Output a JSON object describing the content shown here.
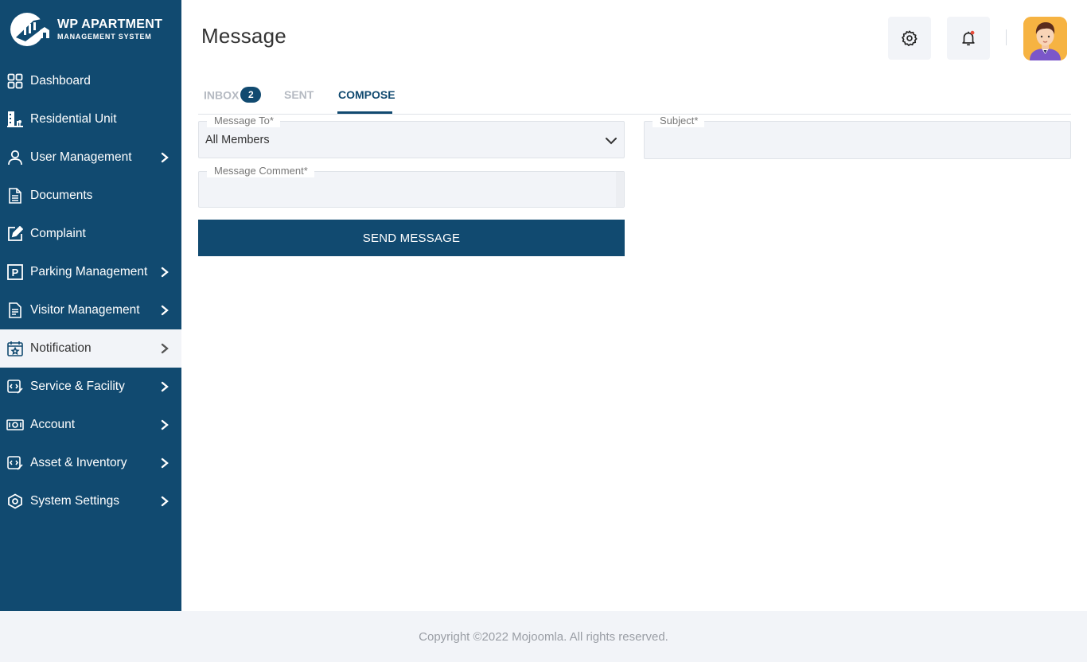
{
  "app": {
    "logo_title": "WP APARTMENT",
    "logo_subtitle": "MANAGEMENT SYSTEM",
    "brand_color": "#114a70"
  },
  "sidebar": {
    "items": [
      {
        "label": "Dashboard",
        "icon": "dashboard-grid-icon",
        "has_submenu": false
      },
      {
        "label": "Residential Unit",
        "icon": "building-icon",
        "has_submenu": false
      },
      {
        "label": "User Management",
        "icon": "user-icon",
        "has_submenu": true
      },
      {
        "label": "Documents",
        "icon": "document-icon",
        "has_submenu": false
      },
      {
        "label": "Complaint",
        "icon": "edit-icon",
        "has_submenu": false
      },
      {
        "label": "Parking Management",
        "icon": "parking-icon",
        "has_submenu": true
      },
      {
        "label": "Visitor Management",
        "icon": "clipboard-icon",
        "has_submenu": true
      },
      {
        "label": "Notification",
        "icon": "calendar-star-icon",
        "has_submenu": true,
        "active": true
      },
      {
        "label": "Service & Facility",
        "icon": "service-icon",
        "has_submenu": true
      },
      {
        "label": "Account",
        "icon": "money-icon",
        "has_submenu": true
      },
      {
        "label": "Asset & Inventory",
        "icon": "inventory-icon",
        "has_submenu": true
      },
      {
        "label": "System Settings",
        "icon": "settings-hex-icon",
        "has_submenu": true
      }
    ]
  },
  "header": {
    "title": "Message",
    "settings_icon": "gear-icon",
    "notification_icon": "bell-icon",
    "notification_dot_color": "#e74c3c"
  },
  "tabs": {
    "inbox": "INBOX",
    "inbox_count": "2",
    "sent": "SENT",
    "compose": "COMPOSE",
    "active": "compose"
  },
  "form": {
    "message_to_label": "Message To*",
    "message_to_value": "All Members",
    "subject_label": "Subject*",
    "subject_value": "",
    "comment_label": "Message Comment*",
    "comment_value": "",
    "send_label": "SEND MESSAGE"
  },
  "footer": {
    "text": "Copyright ©2022 Mojoomla. All rights reserved."
  }
}
